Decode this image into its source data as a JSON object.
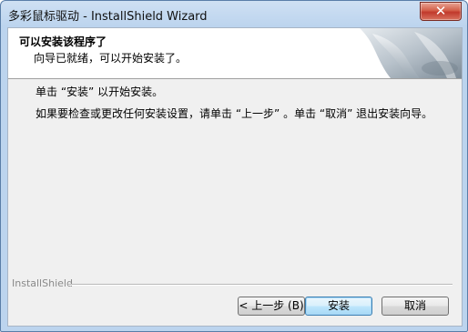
{
  "window": {
    "title": "多彩鼠标驱动 - InstallShield Wizard",
    "close_label": "✕"
  },
  "banner": {
    "title": "可以安装该程序了",
    "subtitle": "向导已就绪，可以开始安装了。"
  },
  "body": {
    "line1": "单击 “安装” 以开始安装。",
    "line2": "如果要检查或更改任何安装设置，请单击 “上一步” 。单击 “取消” 退出安装向导。"
  },
  "footer": {
    "brand": "InstallShield"
  },
  "buttons": {
    "back": "< 上一步 (B)",
    "install": "安装",
    "cancel": "取消"
  }
}
